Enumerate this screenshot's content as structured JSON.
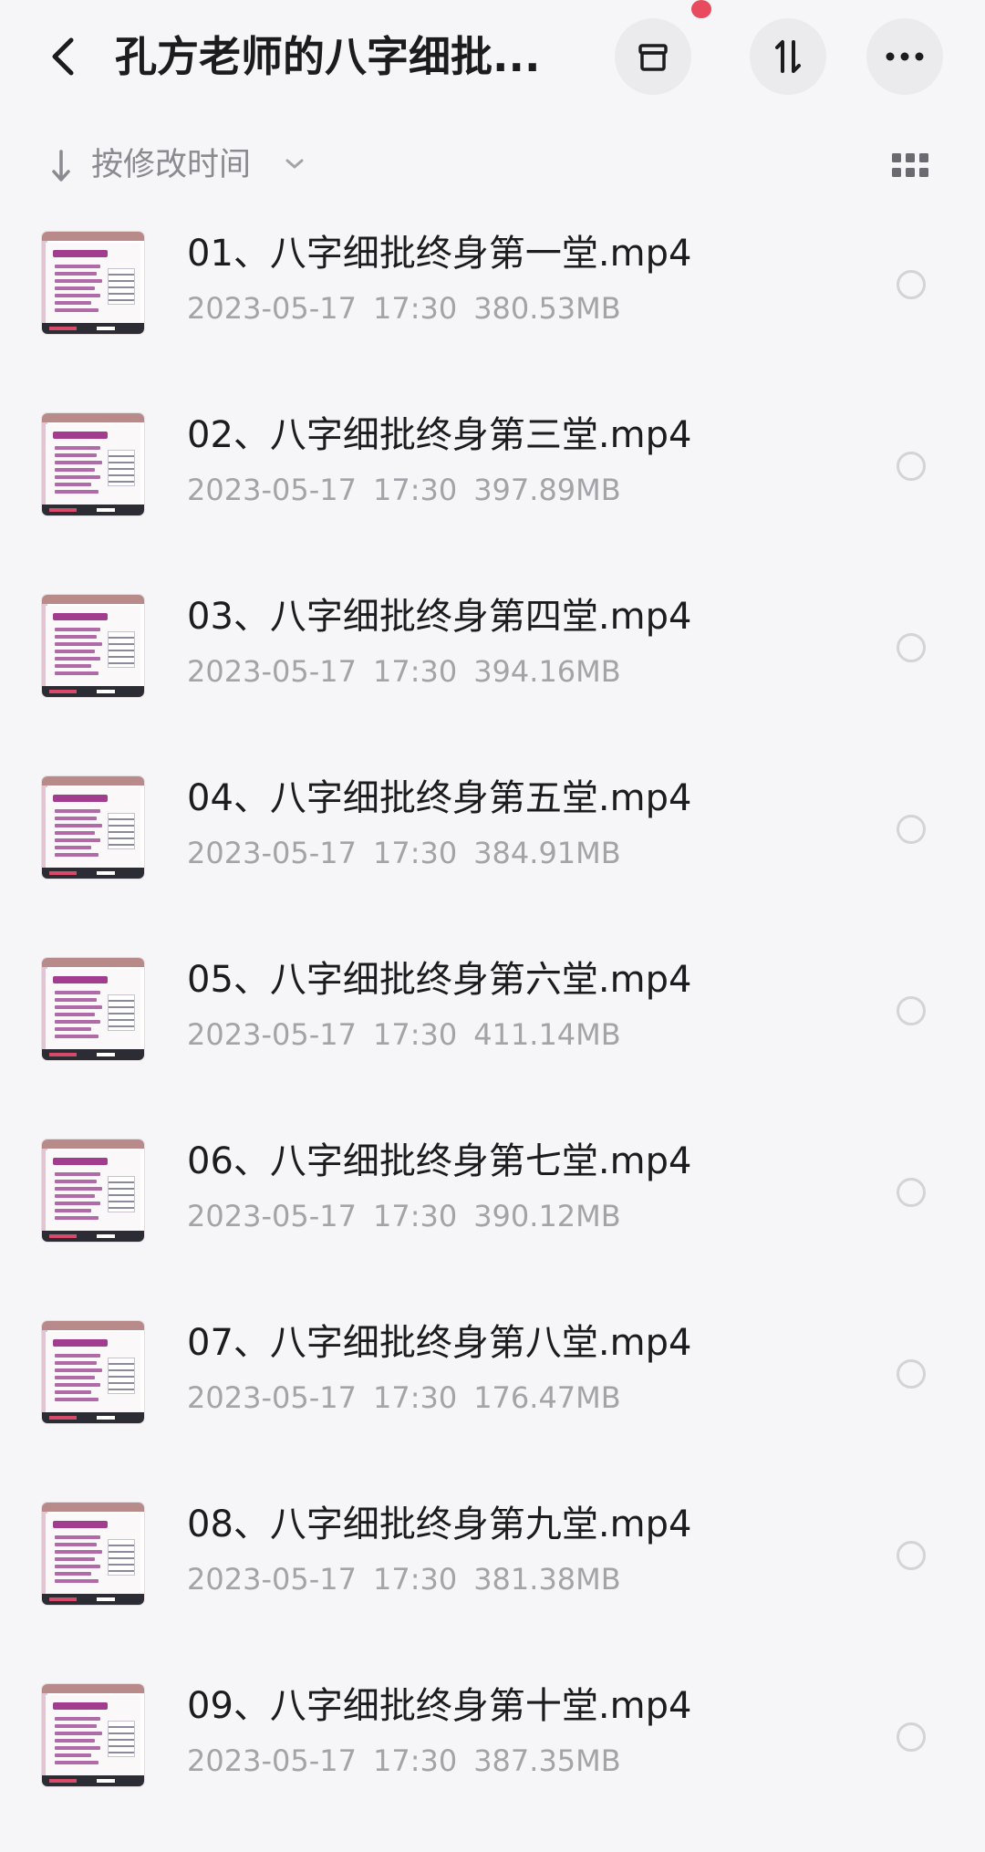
{
  "header": {
    "title": "孔方老师的八字细批...",
    "back_icon": "chevron-left-icon",
    "actions": [
      {
        "name": "archive-icon"
      },
      {
        "name": "sort-toggle-icon"
      },
      {
        "name": "more-icon"
      }
    ],
    "notification_color": "#e84b5e"
  },
  "sort": {
    "label": "按修改时间",
    "direction_icon": "arrow-down-icon",
    "dropdown_icon": "chevron-down-icon",
    "view_icon": "grid-view-icon"
  },
  "files": [
    {
      "name": "01、八字细批终身第一堂.mp4",
      "date": "2023-05-17",
      "time": "17:30",
      "size": "380.53MB"
    },
    {
      "name": "02、八字细批终身第三堂.mp4",
      "date": "2023-05-17",
      "time": "17:30",
      "size": "397.89MB"
    },
    {
      "name": "03、八字细批终身第四堂.mp4",
      "date": "2023-05-17",
      "time": "17:30",
      "size": "394.16MB"
    },
    {
      "name": "04、八字细批终身第五堂.mp4",
      "date": "2023-05-17",
      "time": "17:30",
      "size": "384.91MB"
    },
    {
      "name": "05、八字细批终身第六堂.mp4",
      "date": "2023-05-17",
      "time": "17:30",
      "size": "411.14MB"
    },
    {
      "name": "06、八字细批终身第七堂.mp4",
      "date": "2023-05-17",
      "time": "17:30",
      "size": "390.12MB"
    },
    {
      "name": "07、八字细批终身第八堂.mp4",
      "date": "2023-05-17",
      "time": "17:30",
      "size": "176.47MB"
    },
    {
      "name": "08、八字细批终身第九堂.mp4",
      "date": "2023-05-17",
      "time": "17:30",
      "size": "381.38MB"
    },
    {
      "name": "09、八字细批终身第十堂.mp4",
      "date": "2023-05-17",
      "time": "17:30",
      "size": "387.35MB"
    }
  ]
}
